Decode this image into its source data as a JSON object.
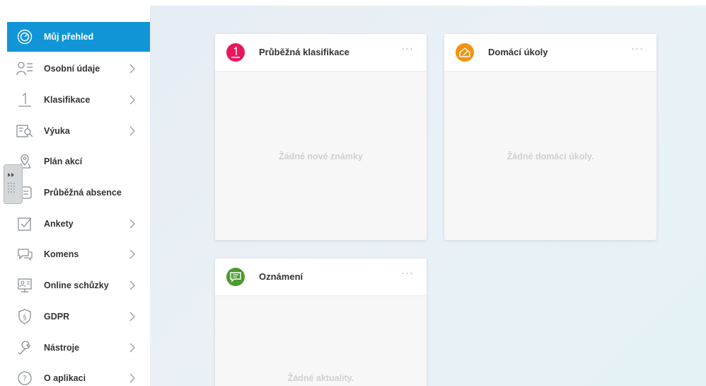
{
  "sidebar": {
    "items": [
      {
        "label": "Můj přehled",
        "icon": "dashboard-gauge-icon",
        "active": true,
        "chevron": false
      },
      {
        "label": "Osobní údaje",
        "icon": "person-list-icon",
        "chevron": true
      },
      {
        "label": "Klasifikace",
        "icon": "grade-one-icon",
        "chevron": true
      },
      {
        "label": "Výuka",
        "icon": "book-search-icon",
        "chevron": true
      },
      {
        "label": "Plán akcí",
        "icon": "map-pin-icon",
        "chevron": false
      },
      {
        "label": "Průběžná absence",
        "icon": "absence-list-icon",
        "chevron": false
      },
      {
        "label": "Ankety",
        "icon": "checkbox-icon",
        "chevron": true
      },
      {
        "label": "Komens",
        "icon": "chat-bubbles-icon",
        "chevron": true
      },
      {
        "label": "Online schůzky",
        "icon": "online-meeting-icon",
        "chevron": true
      },
      {
        "label": "GDPR",
        "icon": "shield-paragraph-icon",
        "chevron": true
      },
      {
        "label": "Nástroje",
        "icon": "wrench-icon",
        "chevron": true
      },
      {
        "label": "O aplikaci",
        "icon": "question-icon",
        "chevron": true
      }
    ]
  },
  "cards": [
    {
      "title": "Průběžná klasifikace",
      "empty_text": "Žádné nové známky",
      "badge_symbol": "1",
      "badge_color": "#e8175d",
      "more": "···"
    },
    {
      "title": "Domácí úkoly",
      "empty_text": "Žádné domácí úkoly.",
      "badge_color": "#f29312",
      "more": "···"
    },
    {
      "title": "Oznámení",
      "empty_text": "Žádné aktuality.",
      "badge_color": "#4b9a2e",
      "more": "···"
    }
  ],
  "colors": {
    "active": "#1195d6",
    "icon": "#8a8f95"
  },
  "handle": {
    "icon": "double-chevron-right-icon"
  }
}
